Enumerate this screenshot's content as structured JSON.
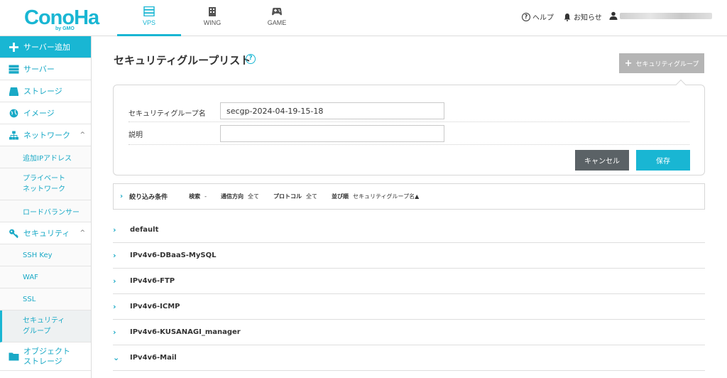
{
  "header": {
    "logo_main": "ConoHa",
    "logo_sub": "by GMO",
    "tabs": [
      {
        "label": "VPS",
        "icon": "server-stack-icon"
      },
      {
        "label": "WING",
        "icon": "building-icon"
      },
      {
        "label": "GAME",
        "icon": "gamepad-icon"
      }
    ],
    "help_label": "ヘルプ",
    "notice_label": "お知らせ"
  },
  "sidebar": {
    "add_server": "サーバー追加",
    "items": [
      {
        "label": "サーバー"
      },
      {
        "label": "ストレージ"
      },
      {
        "label": "イメージ"
      },
      {
        "label": "ネットワーク"
      },
      {
        "label": "追加IPアドレス"
      },
      {
        "label": "プライベート\nネットワーク"
      },
      {
        "label": "ロードバランサー"
      },
      {
        "label": "セキュリティ"
      },
      {
        "label": "SSH Key"
      },
      {
        "label": "WAF"
      },
      {
        "label": "SSL"
      },
      {
        "label": "セキュリティ\nグループ"
      },
      {
        "label": "オブジェクト\nストレージ"
      }
    ]
  },
  "main": {
    "title": "セキュリティグループリスト",
    "help_mark": "?",
    "add_button": "セキュリティグループ",
    "form": {
      "name_label": "セキュリティグループ名",
      "name_value": "secgp-2024-04-19-15-18",
      "desc_label": "説明",
      "desc_value": "",
      "cancel": "キャンセル",
      "save": "保存"
    },
    "filter": {
      "title": "絞り込み条件",
      "search_key": "検索",
      "search_val": "-",
      "direction_key": "通信方向",
      "direction_val": "全て",
      "protocol_key": "プロトコル",
      "protocol_val": "全て",
      "sort_key": "並び順",
      "sort_val": "セキュリティグループ名▲"
    },
    "groups": [
      {
        "name": "default",
        "expanded": false
      },
      {
        "name": "IPv4v6-DBaaS-MySQL",
        "expanded": false
      },
      {
        "name": "IPv4v6-FTP",
        "expanded": false
      },
      {
        "name": "IPv4v6-ICMP",
        "expanded": false
      },
      {
        "name": "IPv4v6-KUSANAGI_manager",
        "expanded": false
      },
      {
        "name": "IPv4v6-Mail",
        "expanded": true
      }
    ]
  },
  "colors": {
    "accent": "#19b6d3",
    "cancel": "#5b6266",
    "disabled": "#b5b5b5"
  }
}
